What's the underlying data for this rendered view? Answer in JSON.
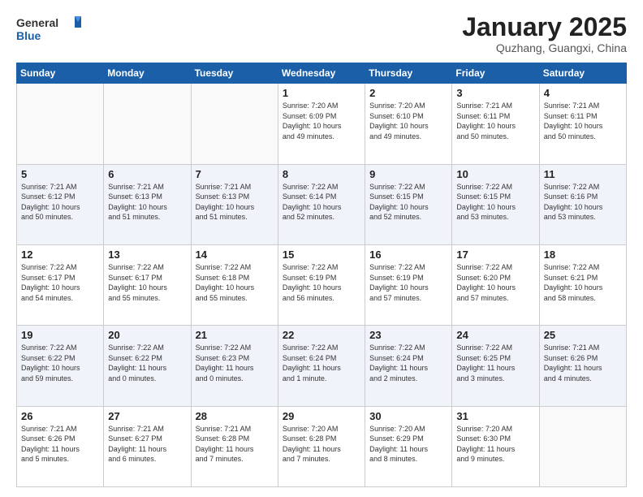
{
  "logo": {
    "line1": "General",
    "line2": "Blue"
  },
  "title": "January 2025",
  "subtitle": "Quzhang, Guangxi, China",
  "weekdays": [
    "Sunday",
    "Monday",
    "Tuesday",
    "Wednesday",
    "Thursday",
    "Friday",
    "Saturday"
  ],
  "weeks": [
    [
      {
        "day": "",
        "info": ""
      },
      {
        "day": "",
        "info": ""
      },
      {
        "day": "",
        "info": ""
      },
      {
        "day": "1",
        "info": "Sunrise: 7:20 AM\nSunset: 6:09 PM\nDaylight: 10 hours\nand 49 minutes."
      },
      {
        "day": "2",
        "info": "Sunrise: 7:20 AM\nSunset: 6:10 PM\nDaylight: 10 hours\nand 49 minutes."
      },
      {
        "day": "3",
        "info": "Sunrise: 7:21 AM\nSunset: 6:11 PM\nDaylight: 10 hours\nand 50 minutes."
      },
      {
        "day": "4",
        "info": "Sunrise: 7:21 AM\nSunset: 6:11 PM\nDaylight: 10 hours\nand 50 minutes."
      }
    ],
    [
      {
        "day": "5",
        "info": "Sunrise: 7:21 AM\nSunset: 6:12 PM\nDaylight: 10 hours\nand 50 minutes."
      },
      {
        "day": "6",
        "info": "Sunrise: 7:21 AM\nSunset: 6:13 PM\nDaylight: 10 hours\nand 51 minutes."
      },
      {
        "day": "7",
        "info": "Sunrise: 7:21 AM\nSunset: 6:13 PM\nDaylight: 10 hours\nand 51 minutes."
      },
      {
        "day": "8",
        "info": "Sunrise: 7:22 AM\nSunset: 6:14 PM\nDaylight: 10 hours\nand 52 minutes."
      },
      {
        "day": "9",
        "info": "Sunrise: 7:22 AM\nSunset: 6:15 PM\nDaylight: 10 hours\nand 52 minutes."
      },
      {
        "day": "10",
        "info": "Sunrise: 7:22 AM\nSunset: 6:15 PM\nDaylight: 10 hours\nand 53 minutes."
      },
      {
        "day": "11",
        "info": "Sunrise: 7:22 AM\nSunset: 6:16 PM\nDaylight: 10 hours\nand 53 minutes."
      }
    ],
    [
      {
        "day": "12",
        "info": "Sunrise: 7:22 AM\nSunset: 6:17 PM\nDaylight: 10 hours\nand 54 minutes."
      },
      {
        "day": "13",
        "info": "Sunrise: 7:22 AM\nSunset: 6:17 PM\nDaylight: 10 hours\nand 55 minutes."
      },
      {
        "day": "14",
        "info": "Sunrise: 7:22 AM\nSunset: 6:18 PM\nDaylight: 10 hours\nand 55 minutes."
      },
      {
        "day": "15",
        "info": "Sunrise: 7:22 AM\nSunset: 6:19 PM\nDaylight: 10 hours\nand 56 minutes."
      },
      {
        "day": "16",
        "info": "Sunrise: 7:22 AM\nSunset: 6:19 PM\nDaylight: 10 hours\nand 57 minutes."
      },
      {
        "day": "17",
        "info": "Sunrise: 7:22 AM\nSunset: 6:20 PM\nDaylight: 10 hours\nand 57 minutes."
      },
      {
        "day": "18",
        "info": "Sunrise: 7:22 AM\nSunset: 6:21 PM\nDaylight: 10 hours\nand 58 minutes."
      }
    ],
    [
      {
        "day": "19",
        "info": "Sunrise: 7:22 AM\nSunset: 6:22 PM\nDaylight: 10 hours\nand 59 minutes."
      },
      {
        "day": "20",
        "info": "Sunrise: 7:22 AM\nSunset: 6:22 PM\nDaylight: 11 hours\nand 0 minutes."
      },
      {
        "day": "21",
        "info": "Sunrise: 7:22 AM\nSunset: 6:23 PM\nDaylight: 11 hours\nand 0 minutes."
      },
      {
        "day": "22",
        "info": "Sunrise: 7:22 AM\nSunset: 6:24 PM\nDaylight: 11 hours\nand 1 minute."
      },
      {
        "day": "23",
        "info": "Sunrise: 7:22 AM\nSunset: 6:24 PM\nDaylight: 11 hours\nand 2 minutes."
      },
      {
        "day": "24",
        "info": "Sunrise: 7:22 AM\nSunset: 6:25 PM\nDaylight: 11 hours\nand 3 minutes."
      },
      {
        "day": "25",
        "info": "Sunrise: 7:21 AM\nSunset: 6:26 PM\nDaylight: 11 hours\nand 4 minutes."
      }
    ],
    [
      {
        "day": "26",
        "info": "Sunrise: 7:21 AM\nSunset: 6:26 PM\nDaylight: 11 hours\nand 5 minutes."
      },
      {
        "day": "27",
        "info": "Sunrise: 7:21 AM\nSunset: 6:27 PM\nDaylight: 11 hours\nand 6 minutes."
      },
      {
        "day": "28",
        "info": "Sunrise: 7:21 AM\nSunset: 6:28 PM\nDaylight: 11 hours\nand 7 minutes."
      },
      {
        "day": "29",
        "info": "Sunrise: 7:20 AM\nSunset: 6:28 PM\nDaylight: 11 hours\nand 7 minutes."
      },
      {
        "day": "30",
        "info": "Sunrise: 7:20 AM\nSunset: 6:29 PM\nDaylight: 11 hours\nand 8 minutes."
      },
      {
        "day": "31",
        "info": "Sunrise: 7:20 AM\nSunset: 6:30 PM\nDaylight: 11 hours\nand 9 minutes."
      },
      {
        "day": "",
        "info": ""
      }
    ]
  ]
}
